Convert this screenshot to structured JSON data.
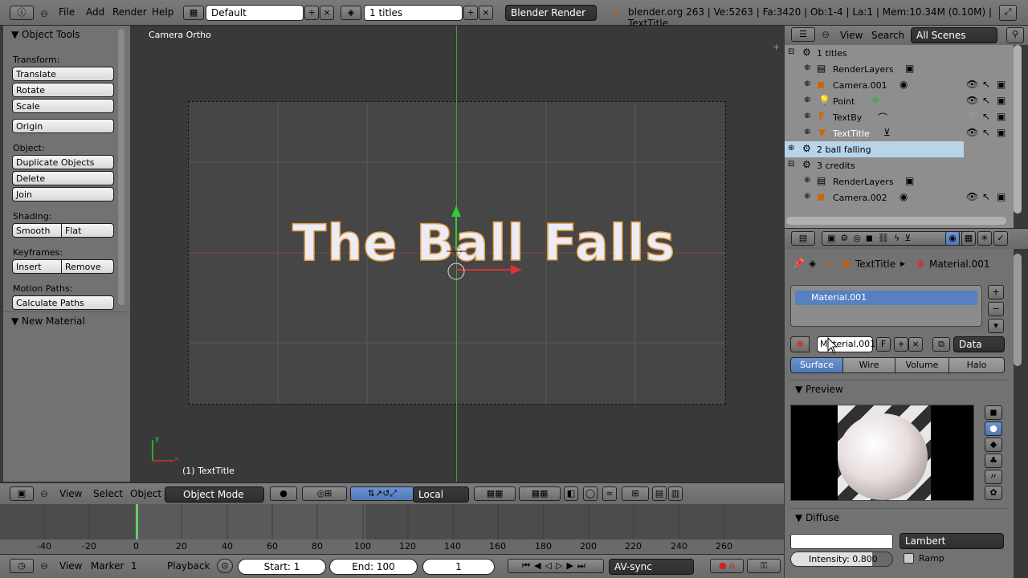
{
  "top_header": {
    "menus": [
      "File",
      "Add",
      "Render",
      "Help"
    ],
    "screen": "Default",
    "scene": "1 titles",
    "engine": "Blender Render",
    "stats": "blender.org 263 | Ve:5263 | Fa:3420 | Ob:1-4 | La:1 | Mem:10.34M (0.10M) | TextTitle"
  },
  "toolshelf": {
    "title": "Object Tools",
    "transform_label": "Transform:",
    "translate": "Translate",
    "rotate": "Rotate",
    "scale": "Scale",
    "origin": "Origin",
    "object_label": "Object:",
    "duplicate": "Duplicate Objects",
    "delete": "Delete",
    "join": "Join",
    "shading_label": "Shading:",
    "smooth": "Smooth",
    "flat": "Flat",
    "keyframes_label": "Keyframes:",
    "insert": "Insert",
    "remove": "Remove",
    "motion_label": "Motion Paths:",
    "calc": "Calculate Paths",
    "new_material": "New Material"
  },
  "viewport": {
    "view_name": "Camera Ortho",
    "title_text": "The Ball Falls",
    "object_label": "(1) TextTitle",
    "axis_x": "x",
    "axis_y": "y"
  },
  "view3d_header": {
    "view": "View",
    "select": "Select",
    "object": "Object",
    "mode": "Object Mode",
    "orientation": "Local"
  },
  "timeline": {
    "ticks": [
      "-40",
      "-20",
      "0",
      "20",
      "40",
      "60",
      "80",
      "100",
      "120",
      "140",
      "160",
      "180",
      "200",
      "220",
      "240",
      "260"
    ],
    "current_frame": 1
  },
  "timeline_header": {
    "view": "View",
    "marker": "Marker",
    "frame": "1",
    "playback": "Playback",
    "start": "Start: 1",
    "end": "End: 100",
    "sync": "AV-sync"
  },
  "outliner": {
    "view": "View",
    "search": "Search",
    "scenes": "All Scenes",
    "rows": [
      {
        "indent": 0,
        "name": "1 titles"
      },
      {
        "indent": 1,
        "name": "RenderLayers"
      },
      {
        "indent": 1,
        "name": "Camera.001"
      },
      {
        "indent": 1,
        "name": "Point"
      },
      {
        "indent": 1,
        "name": "TextBy"
      },
      {
        "indent": 1,
        "name": "TextTitle"
      },
      {
        "indent": 0,
        "name": "2 ball falling"
      },
      {
        "indent": 0,
        "name": "3 credits"
      },
      {
        "indent": 1,
        "name": "RenderLayers"
      },
      {
        "indent": 1,
        "name": "Camera.002"
      }
    ]
  },
  "properties": {
    "crumb_object": "TextTitle",
    "crumb_material": "Material.001",
    "slot": "Material.001",
    "material_name": "Material.001",
    "f": "F",
    "link": "Data",
    "tabs": [
      "Surface",
      "Wire",
      "Volume",
      "Halo"
    ],
    "preview_label": "Preview",
    "diffuse_label": "Diffuse",
    "shader": "Lambert",
    "intensity": "Intensity: 0.800",
    "ramp": "Ramp"
  },
  "colors": {
    "accent": "#5680c2",
    "title_fill": "#ececf6",
    "title_outline": "#e8a040"
  }
}
